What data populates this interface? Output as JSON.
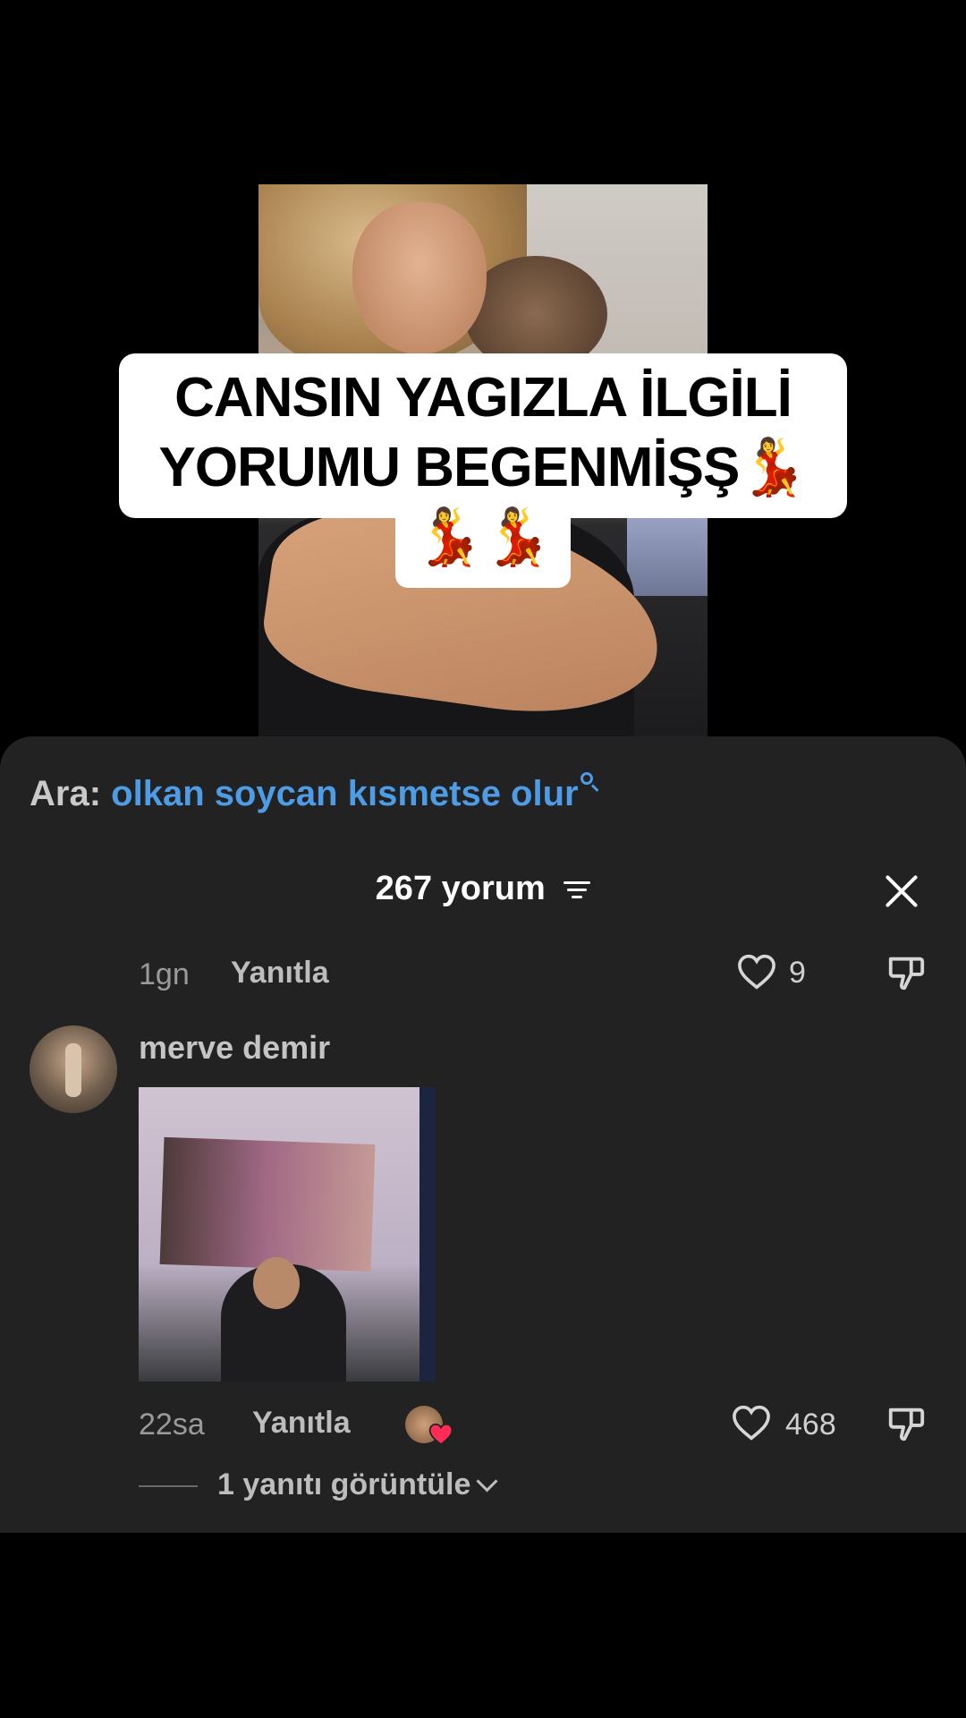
{
  "caption": {
    "text": "CANSIN YAGIZLA İLGİLİ\nYORUMU BEGENMİŞŞ💃\n💃💃"
  },
  "search": {
    "prefix": "Ara:",
    "query": "olkan soycan kısmetse olur"
  },
  "comments_header": {
    "count_label": "267 yorum"
  },
  "previous_comment": {
    "time": "1gn",
    "reply_label": "Yanıtla",
    "likes": "9"
  },
  "comment": {
    "username": "merve demir",
    "time": "22sa",
    "reply_label": "Yanıtla",
    "likes": "468",
    "view_replies_label": "1 yanıtı görüntüle"
  },
  "colors": {
    "accent_link": "#4e9be6",
    "sheet_bg": "#222222",
    "creator_like_heart": "#ff2d55"
  }
}
